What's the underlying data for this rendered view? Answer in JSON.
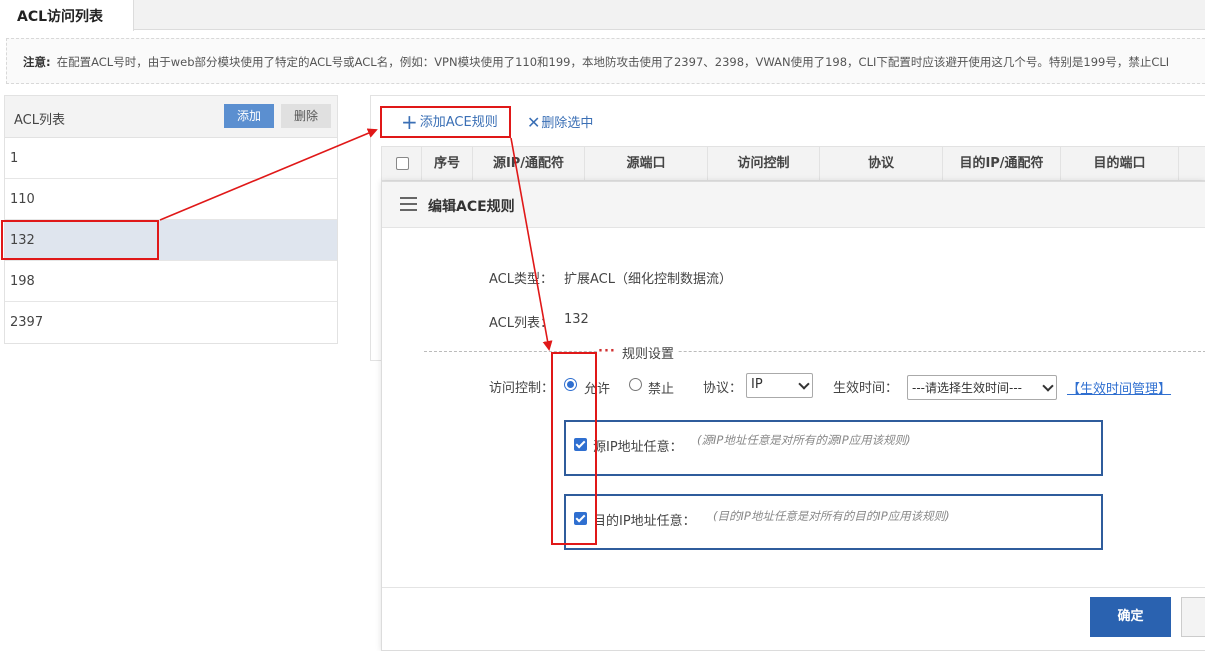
{
  "tabs": {
    "active": "ACL访问列表"
  },
  "notice": {
    "label": "注意:",
    "text": "在配置ACL号时，由于web部分模块使用了特定的ACL号或ACL名，例如：VPN模块使用了110和199，本地防攻击使用了2397、2398，VWAN使用了198，CLI下配置时应该避开使用这几个号。特别是199号，禁止CLI"
  },
  "acl_list": {
    "title": "ACL列表",
    "add_label": "添加",
    "delete_label": "删除",
    "items": [
      "1",
      "110",
      "132",
      "198",
      "2397"
    ],
    "selected": "132"
  },
  "toolbar": {
    "add_rule_label": "添加ACE规则",
    "delete_selected_label": "删除选中"
  },
  "table": {
    "columns": [
      "序号",
      "源IP/通配符",
      "源端口",
      "访问控制",
      "协议",
      "目的IP/通配符",
      "目的端口"
    ]
  },
  "modal": {
    "title": "编辑ACE规则",
    "acl_type_label": "ACL类型：",
    "acl_type_value": "扩展ACL（细化控制数据流）",
    "acl_list_label": "ACL列表：",
    "acl_list_value": "132",
    "section_title": "规则设置",
    "access_label": "访问控制：",
    "allow_label": "允许",
    "deny_label": "禁止",
    "access_selected": "允许",
    "protocol_label": "协议：",
    "protocol_value": "IP",
    "time_label": "生效时间：",
    "time_value": "---请选择生效时间---",
    "time_manage_link": "【生效时间管理】",
    "src_any_label": "源IP地址任意：",
    "src_any_hint": "(源IP地址任意是对所有的源IP应用该规则)",
    "src_any_checked": true,
    "dst_any_label": "目的IP地址任意：",
    "dst_any_hint": "(目的IP地址任意是对所有的目的IP应用该规则)",
    "dst_any_checked": true,
    "ok_label": "确定"
  },
  "colors": {
    "accent": "#2a62b0",
    "annotation": "#e01818",
    "selected_row": "#dfe5ee"
  }
}
